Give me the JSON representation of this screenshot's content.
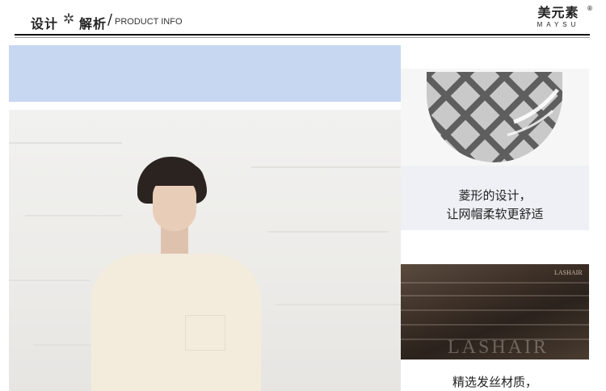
{
  "header": {
    "title_part1": "设计",
    "flower": "✲",
    "title_part2": "解析",
    "slash": "/",
    "title_en": "PRODUCT INFO",
    "brand_cn": "美元素",
    "brand_en": "MAYSU",
    "brand_reg": "®"
  },
  "features": [
    {
      "caption_line1": "菱形的设计，",
      "caption_line2": "让网帽柔软更舒适"
    },
    {
      "caption_line1": "精选发丝材质，",
      "watermark": "LASHAIR",
      "watermark_top": "LASHAIR"
    }
  ],
  "colors": {
    "blue_band": "#c7d7f1",
    "panel_bg": "#eef0f5",
    "hair": "#2b231f"
  }
}
